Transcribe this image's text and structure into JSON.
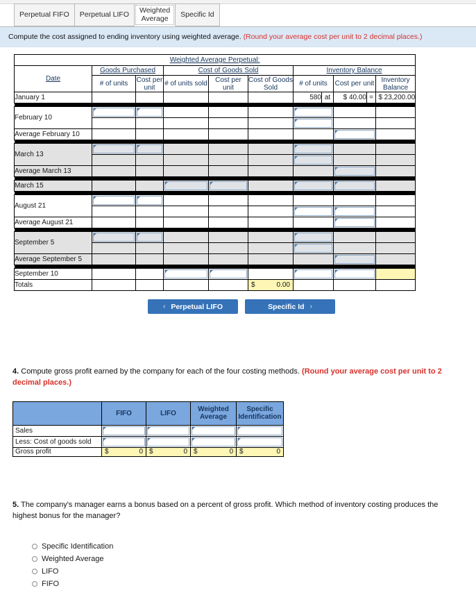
{
  "tabs": [
    {
      "label": "Perpetual FIFO",
      "active": false
    },
    {
      "label": "Perpetual LIFO",
      "active": false
    },
    {
      "label": "Weighted\nAverage",
      "active": true
    },
    {
      "label": "Specific Id",
      "active": false
    }
  ],
  "banner": {
    "text": "Compute the cost assigned to ending inventory using weighted average.",
    "warning": "(Round your average cost per unit to 2 decimal places.)"
  },
  "inventory_table": {
    "title": "Weighted Average Perpetual:",
    "group_headers": {
      "date": "Date",
      "goods_purchased": "Goods Purchased",
      "cost_of_goods_sold": "Cost of Goods Sold",
      "inventory_balance": "Inventory Balance"
    },
    "sub_headers": {
      "gp_units": "# of units",
      "gp_cost": "Cost\nper unit",
      "cogs_units": "# of units\nsold",
      "cogs_cost": "Cost\nper unit",
      "cogs_total": "Cost of Goods Sold",
      "ib_units": "# of units",
      "ib_cost": "Cost\nper unit",
      "ib_balance": "Inventory\nBalance"
    },
    "rows": {
      "january_1": {
        "label": "January 1",
        "ib_units": "580",
        "at": "at",
        "ib_cost": "$ 40.00",
        "eq": "=",
        "ib_balance": "$ 23,200.00"
      },
      "february_10": {
        "label": "February 10"
      },
      "average_february_10": {
        "label": "Average February 10"
      },
      "march_13": {
        "label": "March 13"
      },
      "average_march_13": {
        "label": "Average March 13"
      },
      "march_15": {
        "label": "March 15"
      },
      "august_21": {
        "label": "August 21"
      },
      "average_august_21": {
        "label": "Average August 21"
      },
      "september_5": {
        "label": "September 5"
      },
      "average_september_5": {
        "label": "Average September 5"
      },
      "september_10": {
        "label": "September 10"
      },
      "totals": {
        "label": "Totals",
        "cogs_dollar": "$",
        "cogs_total": "0.00"
      }
    }
  },
  "nav": {
    "prev_label": "Perpetual LIFO",
    "prev_chevron": "‹",
    "next_label": "Specific Id",
    "next_chevron": "›"
  },
  "question4": {
    "number": "4.",
    "text": "Compute gross profit earned by the company for each of the four costing methods.",
    "warning": "(Round your average cost per unit to 2 decimal places.)",
    "table": {
      "columns": [
        "FIFO",
        "LIFO",
        "Weighted\nAverage",
        "Specific\nIdentification"
      ],
      "rows": [
        {
          "label": "Sales",
          "values": [
            "",
            "",
            "",
            ""
          ],
          "highlight": false
        },
        {
          "label": "Less: Cost of goods sold",
          "values": [
            "",
            "",
            "",
            ""
          ],
          "highlight": false
        },
        {
          "label": "Gross profit",
          "dollar": "$",
          "values": [
            "0",
            "0",
            "0",
            "0"
          ],
          "highlight": true
        }
      ]
    }
  },
  "question5": {
    "number": "5.",
    "text": "The company's manager earns a bonus based on a percent of gross profit. Which method of inventory costing produces the highest bonus for the manager?",
    "options": [
      "Specific Identification",
      "Weighted Average",
      "LIFO",
      "FIFO"
    ]
  }
}
